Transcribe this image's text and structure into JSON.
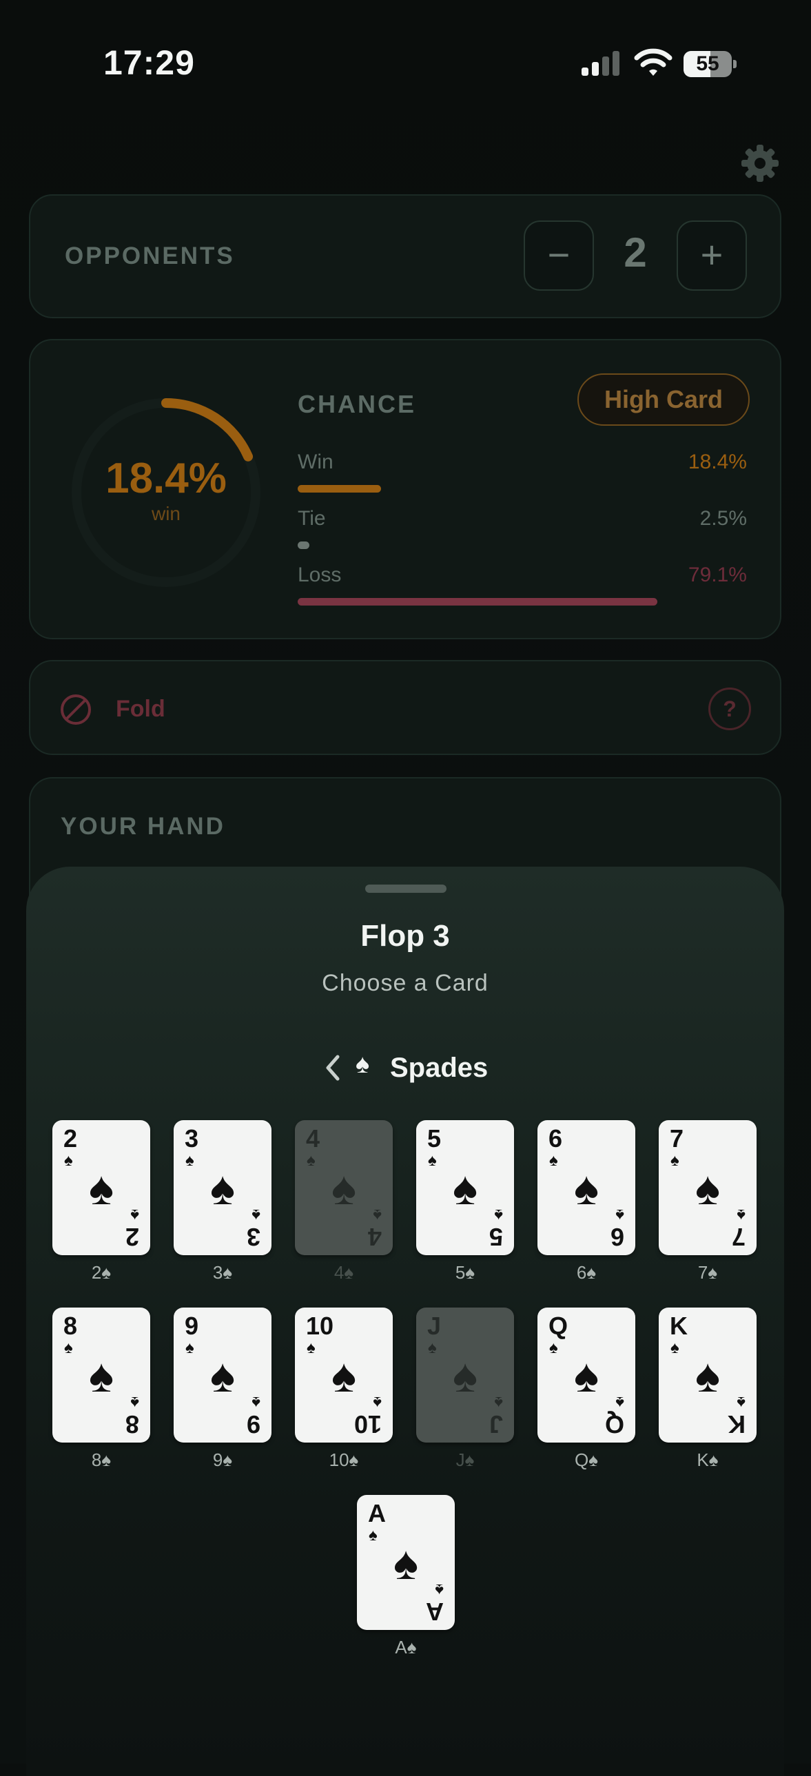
{
  "status_bar": {
    "time": "17:29",
    "battery": "55",
    "battery_level": 0.55
  },
  "opponents": {
    "label": "OPPONENTS",
    "minus": "−",
    "count": "2",
    "plus": "+"
  },
  "chance": {
    "label": "CHANCE",
    "hand_type": "High Card",
    "ring_percent": "18.4%",
    "ring_sub": "win",
    "ring_fraction": 0.184,
    "rows": [
      {
        "label": "Win",
        "value": "18.4%",
        "fraction": 0.184,
        "color": "#9a5e10"
      },
      {
        "label": "Tie",
        "value": "2.5%",
        "fraction": 0.025,
        "color": "#6b7671"
      },
      {
        "label": "Loss",
        "value": "79.1%",
        "fraction": 0.791,
        "color": "#7a3442"
      }
    ]
  },
  "advice": {
    "action": "Fold",
    "help": "?"
  },
  "your_hand": {
    "label": "YOUR HAND"
  },
  "sheet": {
    "title": "Flop 3",
    "subtitle": "Choose a Card",
    "suit_glyph": "♠",
    "suit_name": "Spades",
    "cards": [
      {
        "rank": "2",
        "suit": "♠",
        "caption": "2♠",
        "disabled": false
      },
      {
        "rank": "3",
        "suit": "♠",
        "caption": "3♠",
        "disabled": false
      },
      {
        "rank": "4",
        "suit": "♠",
        "caption": "4♠",
        "disabled": true
      },
      {
        "rank": "5",
        "suit": "♠",
        "caption": "5♠",
        "disabled": false
      },
      {
        "rank": "6",
        "suit": "♠",
        "caption": "6♠",
        "disabled": false
      },
      {
        "rank": "7",
        "suit": "♠",
        "caption": "7♠",
        "disabled": false
      },
      {
        "rank": "8",
        "suit": "♠",
        "caption": "8♠",
        "disabled": false
      },
      {
        "rank": "9",
        "suit": "♠",
        "caption": "9♠",
        "disabled": false
      },
      {
        "rank": "10",
        "suit": "♠",
        "caption": "10♠",
        "disabled": false
      },
      {
        "rank": "J",
        "suit": "♠",
        "caption": "J♠",
        "disabled": true
      },
      {
        "rank": "Q",
        "suit": "♠",
        "caption": "Q♠",
        "disabled": false
      },
      {
        "rank": "K",
        "suit": "♠",
        "caption": "K♠",
        "disabled": false
      },
      {
        "rank": "A",
        "suit": "♠",
        "caption": "A♠",
        "disabled": false
      }
    ]
  }
}
